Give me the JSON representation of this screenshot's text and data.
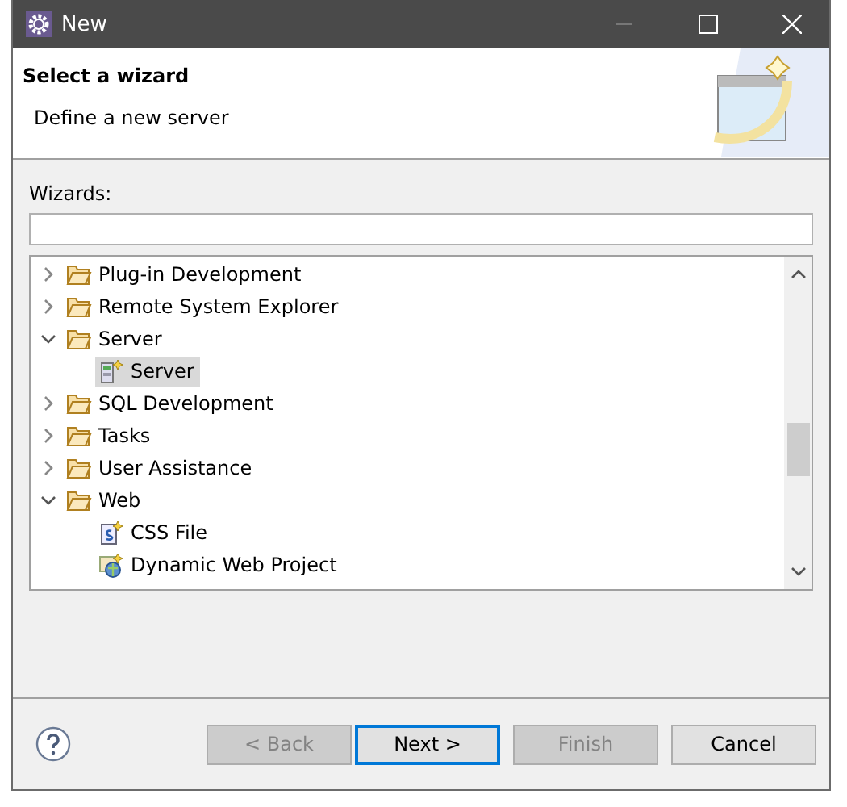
{
  "window": {
    "title": "New"
  },
  "header": {
    "title": "Select a wizard",
    "description": "Define a new server"
  },
  "filter": {
    "label": "Wizards:"
  },
  "tree": [
    {
      "label": "Plug-in Development",
      "kind": "folder",
      "expanded": false,
      "selected": false
    },
    {
      "label": "Remote System Explorer",
      "kind": "folder",
      "expanded": false,
      "selected": false
    },
    {
      "label": "Server",
      "kind": "folder",
      "expanded": true,
      "selected": false,
      "children": [
        {
          "label": "Server",
          "kind": "server",
          "selected": true
        }
      ]
    },
    {
      "label": "SQL Development",
      "kind": "folder",
      "expanded": false,
      "selected": false
    },
    {
      "label": "Tasks",
      "kind": "folder",
      "expanded": false,
      "selected": false
    },
    {
      "label": "User Assistance",
      "kind": "folder",
      "expanded": false,
      "selected": false
    },
    {
      "label": "Web",
      "kind": "folder",
      "expanded": true,
      "selected": false,
      "children": [
        {
          "label": "CSS File",
          "kind": "css",
          "selected": false
        },
        {
          "label": "Dynamic Web Project",
          "kind": "project",
          "selected": false
        }
      ]
    }
  ],
  "buttons": [
    {
      "label": "< Back",
      "disabled": true,
      "default": false
    },
    {
      "label": "Next >",
      "disabled": false,
      "default": true
    },
    {
      "label": "Finish",
      "disabled": true,
      "default": false
    },
    {
      "label": "Cancel",
      "disabled": false,
      "default": false
    }
  ]
}
